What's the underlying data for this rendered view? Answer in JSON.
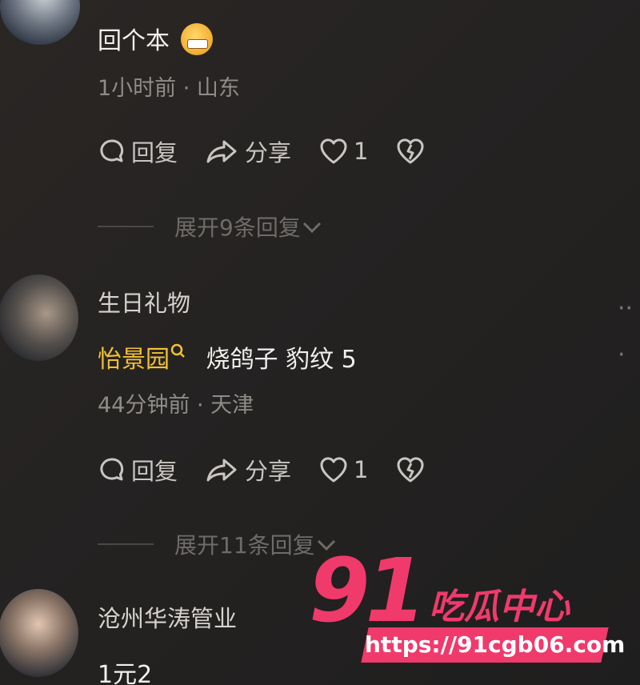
{
  "comments": [
    {
      "author": "",
      "body": "回个本",
      "meta": "1小时前 · 山东",
      "actions": {
        "reply": "回复",
        "share": "分享",
        "likes": "1"
      },
      "expand": "展开9条回复"
    },
    {
      "author": "生日礼物",
      "mention": "怡景园",
      "body": "烧鸽子 豹纹 5",
      "meta": "44分钟前 · 天津",
      "actions": {
        "reply": "回复",
        "share": "分享",
        "likes": "1"
      },
      "expand": "展开11条回复"
    },
    {
      "author": "沧州华涛管业",
      "body": "1元2"
    }
  ],
  "watermark": {
    "number": "91",
    "text": "吃瓜中心",
    "url": "https://91cgb06.com"
  }
}
